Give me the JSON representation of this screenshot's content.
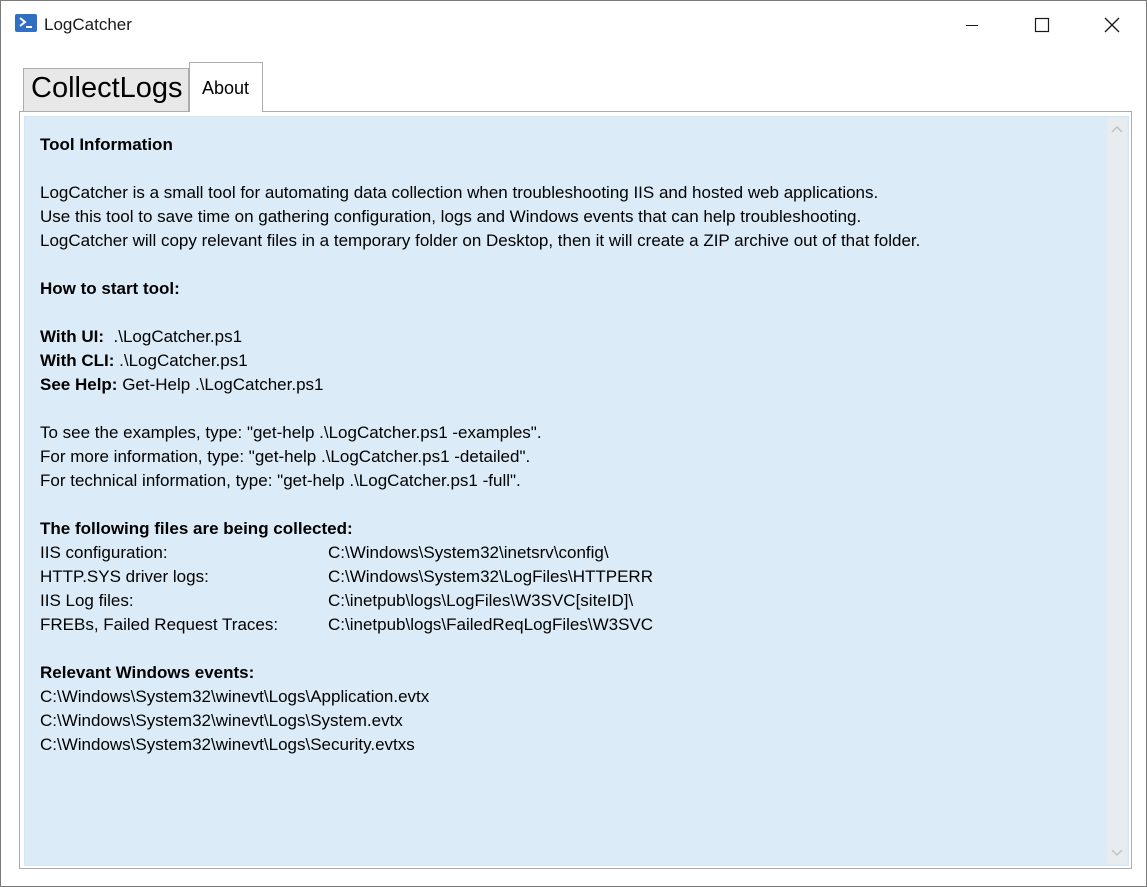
{
  "window": {
    "title": "LogCatcher",
    "icon": "powershell-icon"
  },
  "tabs": [
    {
      "label": "CollectLogs",
      "selected": false
    },
    {
      "label": "About",
      "selected": true
    }
  ],
  "about": {
    "tool_info_heading": "Tool Information",
    "description": [
      "LogCatcher is a small tool for automating data collection when troubleshooting IIS and hosted web applications.",
      "Use this tool to save time on gathering configuration, logs and Windows events that can help troubleshooting.",
      "LogCatcher will copy relevant files in a temporary folder on Desktop, then it will create a ZIP archive out of that folder."
    ],
    "how_to_heading": "How to start tool:",
    "usage": [
      {
        "label": "With UI:",
        "value": "  .\\LogCatcher.ps1"
      },
      {
        "label": "With CLI:",
        "value": " .\\LogCatcher.ps1"
      },
      {
        "label": "See Help:",
        "value": " Get-Help .\\LogCatcher.ps1"
      }
    ],
    "help_lines": [
      "To see the examples, type: \"get-help .\\LogCatcher.ps1 -examples\".",
      "For more information, type: \"get-help .\\LogCatcher.ps1 -detailed\".",
      "For technical information, type: \"get-help .\\LogCatcher.ps1 -full\"."
    ],
    "files_heading": "The following files are being collected:",
    "files": [
      {
        "name": "IIS configuration:",
        "path": "C:\\Windows\\System32\\inetsrv\\config\\"
      },
      {
        "name": "HTTP.SYS driver logs:",
        "path": "C:\\Windows\\System32\\LogFiles\\HTTPERR"
      },
      {
        "name": "IIS Log files:",
        "path": "C:\\inetpub\\logs\\LogFiles\\W3SVC[siteID]\\"
      },
      {
        "name": "FREBs, Failed Request Traces:",
        "path": "C:\\inetpub\\logs\\FailedReqLogFiles\\W3SVC"
      }
    ],
    "events_heading": "Relevant Windows events:",
    "events": [
      "C:\\Windows\\System32\\winevt\\Logs\\Application.evtx",
      "C:\\Windows\\System32\\winevt\\Logs\\System.evtx",
      "C:\\Windows\\System32\\winevt\\Logs\\Security.evtxs"
    ]
  },
  "colors": {
    "text_background": "#dbecf8",
    "icon_blue": "#2f6fc4"
  }
}
